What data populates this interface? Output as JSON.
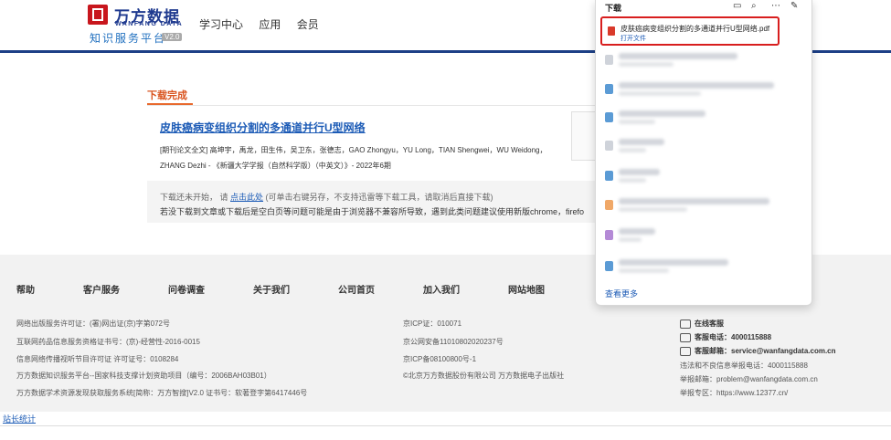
{
  "header": {
    "logo_cn": "万方数据",
    "logo_en": "WANFANG DATA",
    "logo_sub": "知识服务平台",
    "logo_version": "V2.0",
    "nav": [
      "学习中心",
      "应用",
      "会员"
    ]
  },
  "main": {
    "tab_label": "下载完成",
    "paper_title": "皮肤癌病变组织分割的多通道并行U型网络",
    "paper_meta_line1": "[期刊论文全文] 高坤宇，禹龙，田生伟，吴卫东，张德志，GAO Zhongyu，YU Long，TIAN Shengwei，WU Weidong，",
    "paper_meta_line2": "ZHANG Dezhi - 《新疆大学学报（自然科学版）（中英文）》- 2022年6期",
    "notice_prefix": "下载还未开始，   请 ",
    "notice_link": "点击此处",
    "notice_suffix": " (可单击右键另存，不支持迅雷等下载工具，请取消后直接下载)",
    "notice_line2": "若没下载到文章或下载后是空白页等问题可能是由于浏览器不兼容所导致，遇到此类问题建议使用新版chrome，firefo"
  },
  "footer": {
    "links": [
      "帮助",
      "客户服务",
      "问卷调查",
      "关于我们",
      "公司首页",
      "加入我们",
      "网站地图"
    ],
    "col1": [
      "网络出版服务许可证：(署)网出证(京)字第072号",
      "互联网药品信息服务资格证书号：(京)-经营性-2016-0015",
      "信息网络传播视听节目许可证 许可证号：0108284",
      "万方数据知识服务平台--国家科技支撑计划资助项目（编号：2006BAH03B01）",
      "万方数据学术资源发现获取服务系统[简称：万方智搜]V2.0 证书号：软著登字第6417446号"
    ],
    "col2": [
      "京ICP证：010071",
      "京公网安备11010802020237号",
      "京ICP备08100800号-1",
      "©北京万方数据股份有限公司 万方数据电子出版社"
    ],
    "online_service": "在线客服",
    "phone_label": "客服电话：",
    "phone": "4000115888",
    "email_label": "客服邮箱：",
    "email": "service@wanfangdata.com.cn",
    "report_phone": "违法和不良信息举报电话：4000115888",
    "report_email": "举报邮箱：problem@wanfangdata.com.cn",
    "report_zone": "举报专区：https://www.12377.cn/",
    "stat": "站长统计"
  },
  "downloads_panel": {
    "title": "下载",
    "item_name": "皮肤癌病变组织分割的多通道并行U型网络.pdf",
    "item_action": "打开文件",
    "more": "查看更多",
    "accent": "#d81e1e"
  }
}
